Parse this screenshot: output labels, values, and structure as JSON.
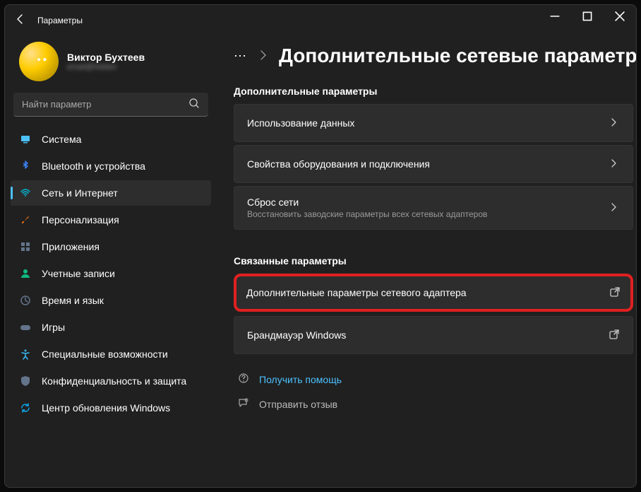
{
  "window": {
    "title": "Параметры"
  },
  "profile": {
    "name": "Виктор Бухтеев",
    "email": "email@hidden"
  },
  "search": {
    "placeholder": "Найти параметр"
  },
  "nav": [
    {
      "id": "system",
      "label": "Система",
      "icon": "display",
      "color": "#4cc2ff"
    },
    {
      "id": "bluetooth",
      "label": "Bluetooth и устройства",
      "icon": "bluetooth",
      "color": "#3b82f6"
    },
    {
      "id": "network",
      "label": "Сеть и Интернет",
      "icon": "wifi",
      "color": "#06b6d4",
      "selected": true
    },
    {
      "id": "personalization",
      "label": "Персонализация",
      "icon": "brush",
      "color": "#f97316"
    },
    {
      "id": "apps",
      "label": "Приложения",
      "icon": "apps",
      "color": "#64748b"
    },
    {
      "id": "accounts",
      "label": "Учетные записи",
      "icon": "person",
      "color": "#10b981"
    },
    {
      "id": "time",
      "label": "Время и язык",
      "icon": "clock",
      "color": "#64748b"
    },
    {
      "id": "gaming",
      "label": "Игры",
      "icon": "game",
      "color": "#64748b"
    },
    {
      "id": "accessibility",
      "label": "Специальные возможности",
      "icon": "accessibility",
      "color": "#38bdf8"
    },
    {
      "id": "privacy",
      "label": "Конфиденциальность и защита",
      "icon": "shield",
      "color": "#64748b"
    },
    {
      "id": "update",
      "label": "Центр обновления Windows",
      "icon": "update",
      "color": "#0ea5e9"
    }
  ],
  "breadcrumb": {
    "more": "⋯",
    "title": "Дополнительные сетевые параметр"
  },
  "sections": {
    "extra": {
      "heading": "Дополнительные параметры",
      "items": [
        {
          "id": "data-usage",
          "title": "Использование данных",
          "trail": "chevron"
        },
        {
          "id": "hardware",
          "title": "Свойства оборудования и подключения",
          "trail": "chevron"
        },
        {
          "id": "reset",
          "title": "Сброс сети",
          "sub": "Восстановить заводские параметры всех сетевых адаптеров",
          "trail": "chevron"
        }
      ]
    },
    "related": {
      "heading": "Связанные параметры",
      "items": [
        {
          "id": "adapter-options",
          "title": "Дополнительные параметры сетевого адаптера",
          "trail": "external",
          "highlight": true
        },
        {
          "id": "firewall",
          "title": "Брандмауэр Windows",
          "trail": "external"
        }
      ]
    }
  },
  "footer": {
    "help": "Получить помощь",
    "feedback": "Отправить отзыв"
  }
}
